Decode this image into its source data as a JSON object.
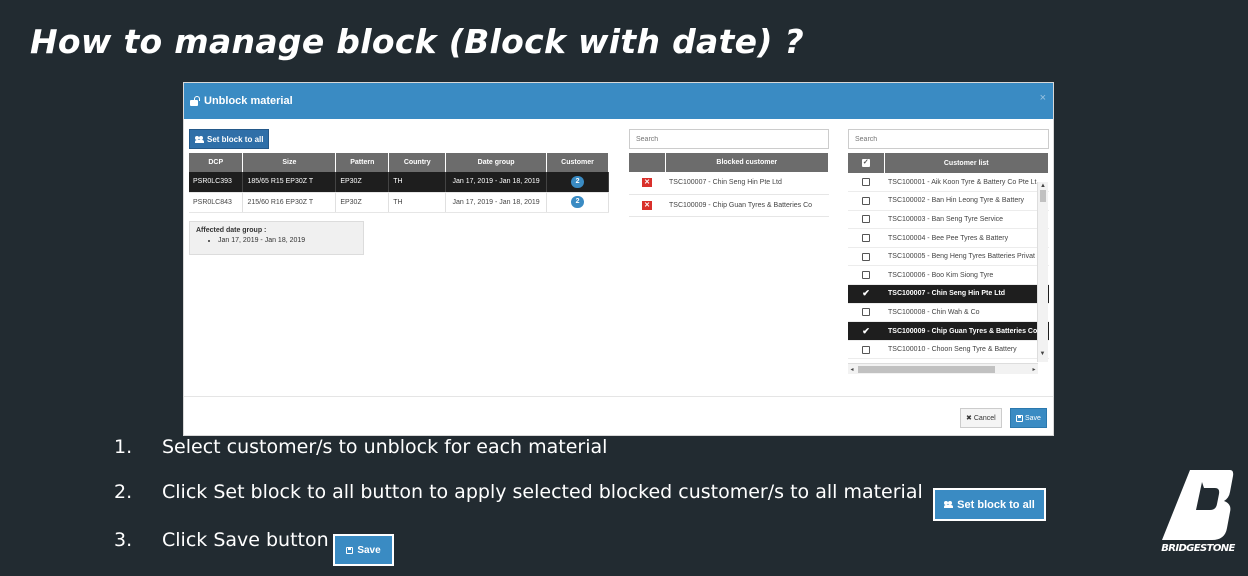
{
  "slide": {
    "title": "How to manage block (Block with date) ?"
  },
  "modal": {
    "title": "Unblock material",
    "close_label": "×",
    "set_block_label": "Set block to all",
    "material_table": {
      "headers": [
        "DCP",
        "Size",
        "Pattern",
        "Country",
        "Date group",
        "Customer"
      ],
      "rows": [
        {
          "dcp": "PSR0LC393",
          "size": "185/65 R15 EP30Z T",
          "pattern": "EP30Z",
          "country": "TH",
          "date_group": "Jan 17, 2019 - Jan 18, 2019",
          "customer_count": "2",
          "selected": true
        },
        {
          "dcp": "PSR0LC843",
          "size": "215/60 R16 EP30Z T",
          "pattern": "EP30Z",
          "country": "TH",
          "date_group": "Jan 17, 2019 - Jan 18, 2019",
          "customer_count": "2",
          "selected": false
        }
      ]
    },
    "affected": {
      "label": "Affected date group :",
      "items": [
        "Jan 17, 2019 - Jan 18, 2019"
      ]
    },
    "blocked_search_placeholder": "Search",
    "blocked_table": {
      "header": "Blocked customer",
      "rows": [
        "TSC100007 - Chin Seng Hin Pte Ltd",
        "TSC100009 - Chip Guan Tyres & Batteries Co"
      ]
    },
    "customer_search_placeholder": "Search",
    "customer_table": {
      "header": "Customer list",
      "rows": [
        {
          "name": "TSC100001 - Aik Koon Tyre & Battery Co Pte Lt",
          "checked": false
        },
        {
          "name": "TSC100002 - Ban Hin Leong Tyre & Battery",
          "checked": false
        },
        {
          "name": "TSC100003 - Ban Seng Tyre Service",
          "checked": false
        },
        {
          "name": "TSC100004 - Bee Pee Tyres & Battery",
          "checked": false
        },
        {
          "name": "TSC100005 - Beng Heng Tyres Batteries Privat",
          "checked": false
        },
        {
          "name": "TSC100006 - Boo Kim Siong Tyre",
          "checked": false
        },
        {
          "name": "TSC100007 - Chin Seng Hin Pte Ltd",
          "checked": true
        },
        {
          "name": "TSC100008 - Chin Wah & Co",
          "checked": false
        },
        {
          "name": "TSC100009 - Chip Guan Tyres & Batteries Co",
          "checked": true
        },
        {
          "name": "TSC100010 - Choon Seng Tyre & Battery",
          "checked": false
        }
      ]
    },
    "cancel_label": "Cancel",
    "save_label": "Save"
  },
  "steps": [
    {
      "num": "1.",
      "text": "Select customer/s to unblock for each material"
    },
    {
      "num": "2.",
      "text": "Click Set block to all button to apply selected blocked customer/s to all material"
    },
    {
      "num": "3.",
      "text": "Click Save button"
    }
  ],
  "inline_buttons": {
    "set_block_label": "Set block to all",
    "save_label": "Save"
  },
  "brand": {
    "name": "BRIDGESTONE"
  },
  "colors": {
    "background": "#222b31",
    "header_blue": "#3a8bc3",
    "primary_button": "#2f6fa8",
    "selected_row": "#1e1e1e",
    "delete_red": "#d9302b"
  }
}
